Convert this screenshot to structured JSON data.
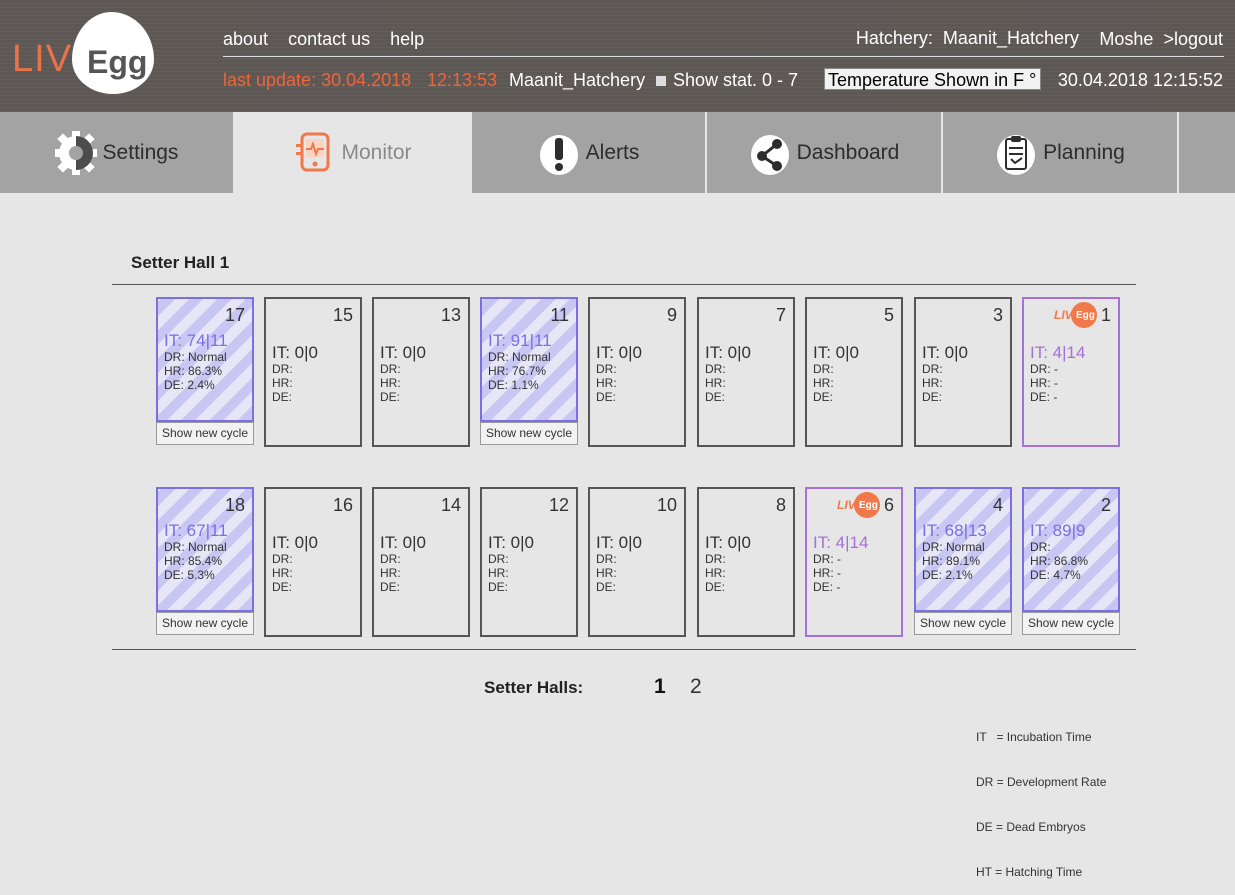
{
  "header": {
    "logo_liv": "LIV",
    "logo_egg": "Egg",
    "nav": [
      "about",
      "contact us",
      "help"
    ],
    "hatchery_label": "Hatchery:",
    "hatchery_name": "Maanit_Hatchery",
    "user": "Moshe",
    "logout": ">logout",
    "last_update": "last update: 30.04.2018",
    "last_update_time": "12:13:53",
    "hatchery_current": "Maanit_Hatchery",
    "show_stat": "Show stat. 0 - 7",
    "temperature_select": "Temperature Shown in   F °",
    "datetime": "30.04.2018 12:15:52",
    "colors": {
      "accent": "#f0643c",
      "header_bg": "#5e5955"
    }
  },
  "tabs": [
    {
      "label": "Settings",
      "icon": "gear-icon"
    },
    {
      "label": "Monitor",
      "icon": "monitor-icon",
      "active": true
    },
    {
      "label": "Alerts",
      "icon": "alert-icon"
    },
    {
      "label": "Dashboard",
      "icon": "share-icon"
    },
    {
      "label": "Planning",
      "icon": "clipboard-icon"
    }
  ],
  "hall": {
    "title": "Setter Hall 1",
    "button_label": "Show new cycle",
    "row1": [
      {
        "num": "17",
        "it": "IT: 74|11",
        "dr": "DR: Normal",
        "hr": "HR: 86.3%",
        "de": "DE: 2.4%",
        "style": "striped"
      },
      {
        "num": "15",
        "it": "IT: 0|0",
        "dr": "DR:",
        "hr": "HR:",
        "de": "DE:",
        "style": "plain"
      },
      {
        "num": "13",
        "it": "IT: 0|0",
        "dr": "DR:",
        "hr": "HR:",
        "de": "DE:",
        "style": "plain"
      },
      {
        "num": "11",
        "it": "IT: 91|11",
        "dr": "DR: Normal",
        "hr": "HR: 76.7%",
        "de": "DE: 1.1%",
        "style": "striped"
      },
      {
        "num": "9",
        "it": "IT: 0|0",
        "dr": "DR:",
        "hr": "HR:",
        "de": "DE:",
        "style": "plain"
      },
      {
        "num": "7",
        "it": "IT: 0|0",
        "dr": "DR:",
        "hr": "HR:",
        "de": "DE:",
        "style": "plain"
      },
      {
        "num": "5",
        "it": "IT: 0|0",
        "dr": "DR:",
        "hr": "HR:",
        "de": "DE:",
        "style": "plain"
      },
      {
        "num": "3",
        "it": "IT: 0|0",
        "dr": "DR:",
        "hr": "HR:",
        "de": "DE:",
        "style": "plain"
      },
      {
        "num": "1",
        "it": "IT: 4|14",
        "dr": "DR: -",
        "hr": "HR: -",
        "de": "DE: -",
        "style": "egg"
      }
    ],
    "row2": [
      {
        "num": "18",
        "it": "IT: 67|11",
        "dr": "DR: Normal",
        "hr": "HR: 85.4%",
        "de": "DE: 5.3%",
        "style": "striped"
      },
      {
        "num": "16",
        "it": "IT: 0|0",
        "dr": "DR:",
        "hr": "HR:",
        "de": "DE:",
        "style": "plain"
      },
      {
        "num": "14",
        "it": "IT: 0|0",
        "dr": "DR:",
        "hr": "HR:",
        "de": "DE:",
        "style": "plain"
      },
      {
        "num": "12",
        "it": "IT: 0|0",
        "dr": "DR:",
        "hr": "HR:",
        "de": "DE:",
        "style": "plain"
      },
      {
        "num": "10",
        "it": "IT: 0|0",
        "dr": "DR:",
        "hr": "HR:",
        "de": "DE:",
        "style": "plain"
      },
      {
        "num": "8",
        "it": "IT: 0|0",
        "dr": "DR:",
        "hr": "HR:",
        "de": "DE:",
        "style": "plain"
      },
      {
        "num": "6",
        "it": "IT: 4|14",
        "dr": "DR: -",
        "hr": "HR: -",
        "de": "DE: -",
        "style": "egg"
      },
      {
        "num": "4",
        "it": "IT: 68|13",
        "dr": "DR: Normal",
        "hr": "HR: 89.1%",
        "de": "DE: 2.1%",
        "style": "striped"
      },
      {
        "num": "2",
        "it": "IT: 89|9",
        "dr": "DR:",
        "hr": "HR: 86.8%",
        "de": "DE: 4.7%",
        "style": "striped"
      }
    ]
  },
  "pager": {
    "label": "Setter Halls:",
    "pages": [
      "1",
      "2"
    ],
    "current": "1"
  },
  "legend": [
    "IT   = Incubation Time",
    "DR = Development Rate",
    "DE = Dead Embryos",
    "HT = Hatching Time"
  ]
}
